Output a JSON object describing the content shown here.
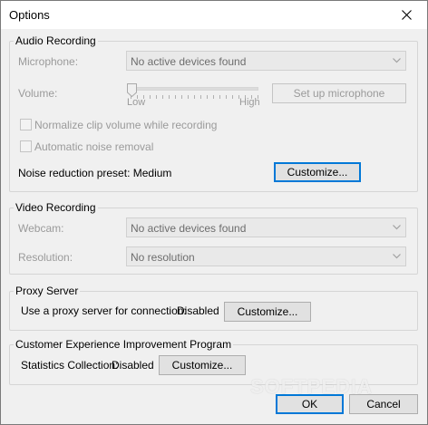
{
  "window": {
    "title": "Options"
  },
  "audio": {
    "group_title": "Audio Recording",
    "microphone_label": "Microphone:",
    "microphone_value": "No active devices found",
    "volume_label": "Volume:",
    "volume_low": "Low",
    "volume_high": "High",
    "volume_level": 0,
    "setup_button": "Set up microphone",
    "normalize_label": "Normalize clip volume while recording",
    "normalize_checked": false,
    "noise_label": "Automatic noise removal",
    "noise_checked": false,
    "preset_label": "Noise reduction preset: Medium",
    "customize_button": "Customize..."
  },
  "video": {
    "group_title": "Video Recording",
    "webcam_label": "Webcam:",
    "webcam_value": "No active devices found",
    "resolution_label": "Resolution:",
    "resolution_value": "No resolution"
  },
  "proxy": {
    "group_title": "Proxy Server",
    "label": "Use a proxy server for connection:",
    "status": "Disabled",
    "customize_button": "Customize..."
  },
  "ceip": {
    "group_title": "Customer Experience Improvement Program",
    "label": "Statistics Collection:",
    "status": "Disabled",
    "customize_button": "Customize..."
  },
  "footer": {
    "ok_button": "OK",
    "cancel_button": "Cancel"
  },
  "watermark": "SOFTPEDIA",
  "colors": {
    "focus_border": "#0078d7",
    "disabled_text": "#9a9a9a"
  },
  "icons": {
    "close": "close-icon",
    "dropdown": "chevron-down-icon"
  }
}
